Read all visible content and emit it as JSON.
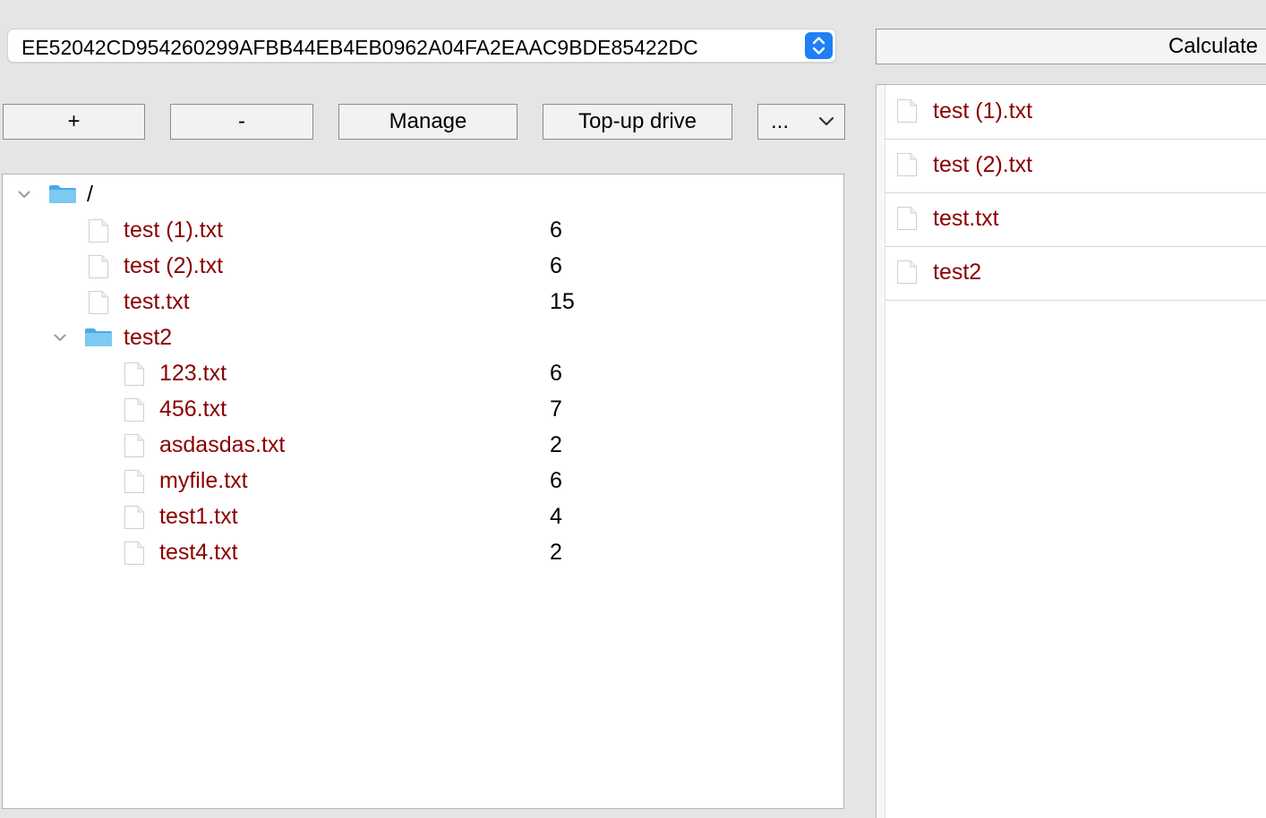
{
  "drive_selector": {
    "value": "EE52042CD954260299AFBB44EB4EB0962A04FA2EAAC9BDE85422DC"
  },
  "calculate_button": {
    "label": "Calculate"
  },
  "toolbar": {
    "add_label": "+",
    "remove_label": "-",
    "manage_label": "Manage",
    "topup_label": "Top-up drive",
    "more_label": "..."
  },
  "tree": {
    "root": {
      "name": "/",
      "expanded": true
    },
    "root_files": [
      {
        "name": "test (1).txt",
        "size": "6"
      },
      {
        "name": "test (2).txt",
        "size": "6"
      },
      {
        "name": "test.txt",
        "size": "15"
      }
    ],
    "subfolder": {
      "name": "test2",
      "expanded": true
    },
    "subfolder_files": [
      {
        "name": "123.txt",
        "size": "6"
      },
      {
        "name": "456.txt",
        "size": "7"
      },
      {
        "name": "asdasdas.txt",
        "size": "2"
      },
      {
        "name": "myfile.txt",
        "size": "6"
      },
      {
        "name": "test1.txt",
        "size": "4"
      },
      {
        "name": "test4.txt",
        "size": "2"
      }
    ]
  },
  "right_list": {
    "items": [
      {
        "name": "test (1).txt",
        "icon": "file-icon"
      },
      {
        "name": "test (2).txt",
        "icon": "file-icon"
      },
      {
        "name": "test.txt",
        "icon": "file-icon"
      },
      {
        "name": "test2",
        "icon": "file-icon"
      }
    ]
  },
  "colors": {
    "file_name": "#8b0000",
    "accent": "#1f7ff5",
    "folder": "#5fbdf0"
  }
}
